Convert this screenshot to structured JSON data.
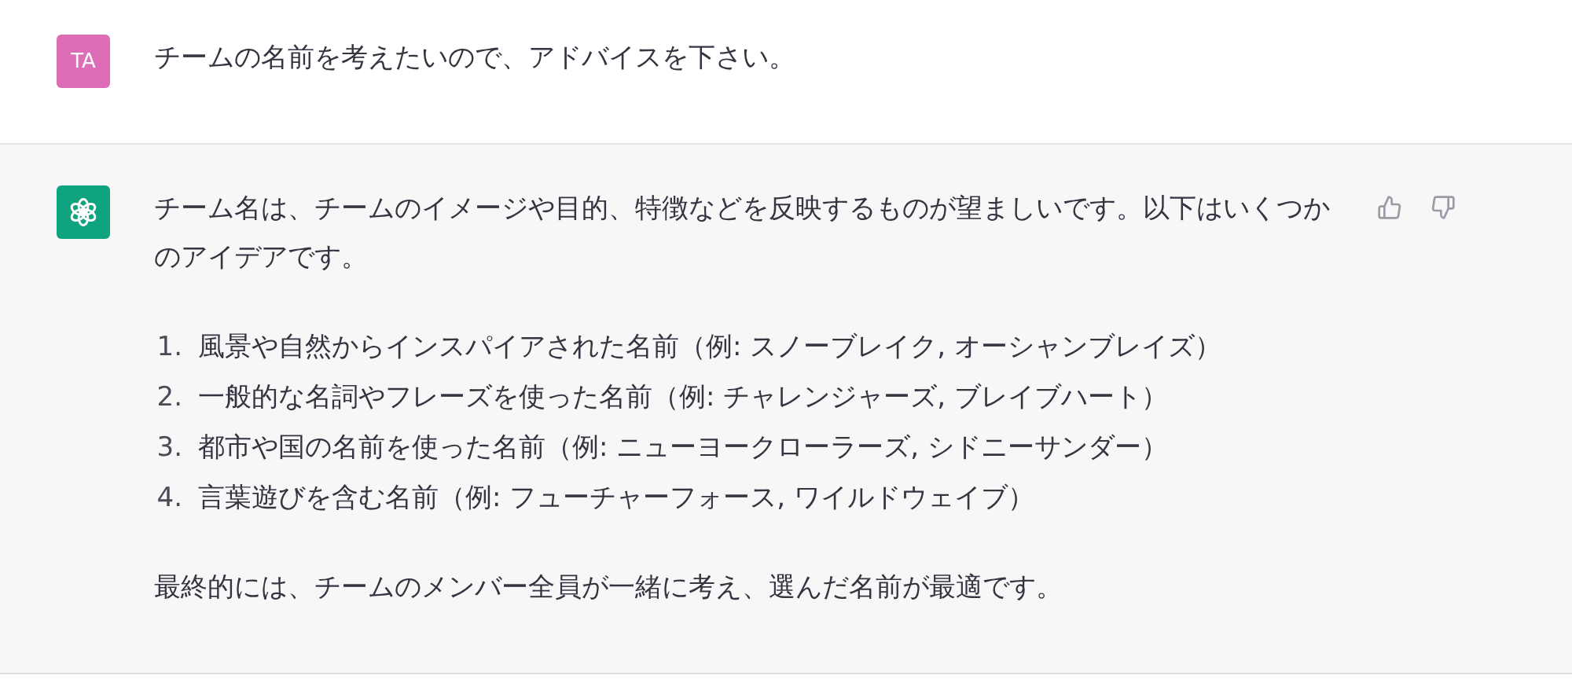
{
  "messages": [
    {
      "kind": "user",
      "avatar": "TA",
      "paragraphs": [
        {
          "kind": "text",
          "text": "チームの名前を考えたいので、アドバイスを下さい。"
        }
      ]
    },
    {
      "kind": "assistant",
      "paragraphs": [
        {
          "kind": "text",
          "text": "チーム名は、チームのイメージや目的、特徴などを反映するものが望ましいです。以下はいくつかのアイデアです。"
        },
        {
          "kind": "list",
          "items": [
            {
              "number": "1.",
              "text": "風景や自然からインスパイアされた名前（例: スノーブレイク, オーシャンブレイズ）"
            },
            {
              "number": "2.",
              "text": "一般的な名詞やフレーズを使った名前（例: チャレンジャーズ, ブレイブハート）"
            },
            {
              "number": "3.",
              "text": "都市や国の名前を使った名前（例: ニューヨークローラーズ, シドニーサンダー）"
            },
            {
              "number": "4.",
              "text": "言葉遊びを含む名前（例: フューチャーフォース, ワイルドウェイブ）"
            }
          ]
        },
        {
          "kind": "text",
          "text": "最終的には、チームのメンバー全員が一緒に考え、選んだ名前が最適です。"
        }
      ]
    }
  ]
}
